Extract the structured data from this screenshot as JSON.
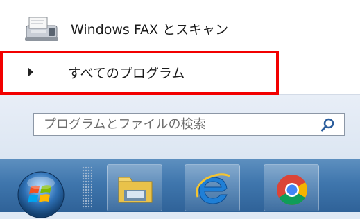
{
  "start_menu": {
    "fax_item": {
      "label": "Windows FAX とスキャン",
      "icon": "fax-scanner-icon"
    },
    "all_programs": {
      "label": "すべてのプログラム",
      "icon": "arrow-right-icon"
    },
    "search": {
      "placeholder": "プログラムとファイルの検索",
      "value": "",
      "icon": "search-icon"
    }
  },
  "highlight": {
    "color": "#f20000"
  },
  "taskbar": {
    "start_button": {
      "icon": "windows-start-orb-icon"
    },
    "pinned": [
      {
        "name": "explorer",
        "icon": "folder-icon"
      },
      {
        "name": "internet-explorer",
        "icon": "internet-explorer-icon"
      },
      {
        "name": "chrome",
        "icon": "chrome-icon"
      }
    ]
  }
}
